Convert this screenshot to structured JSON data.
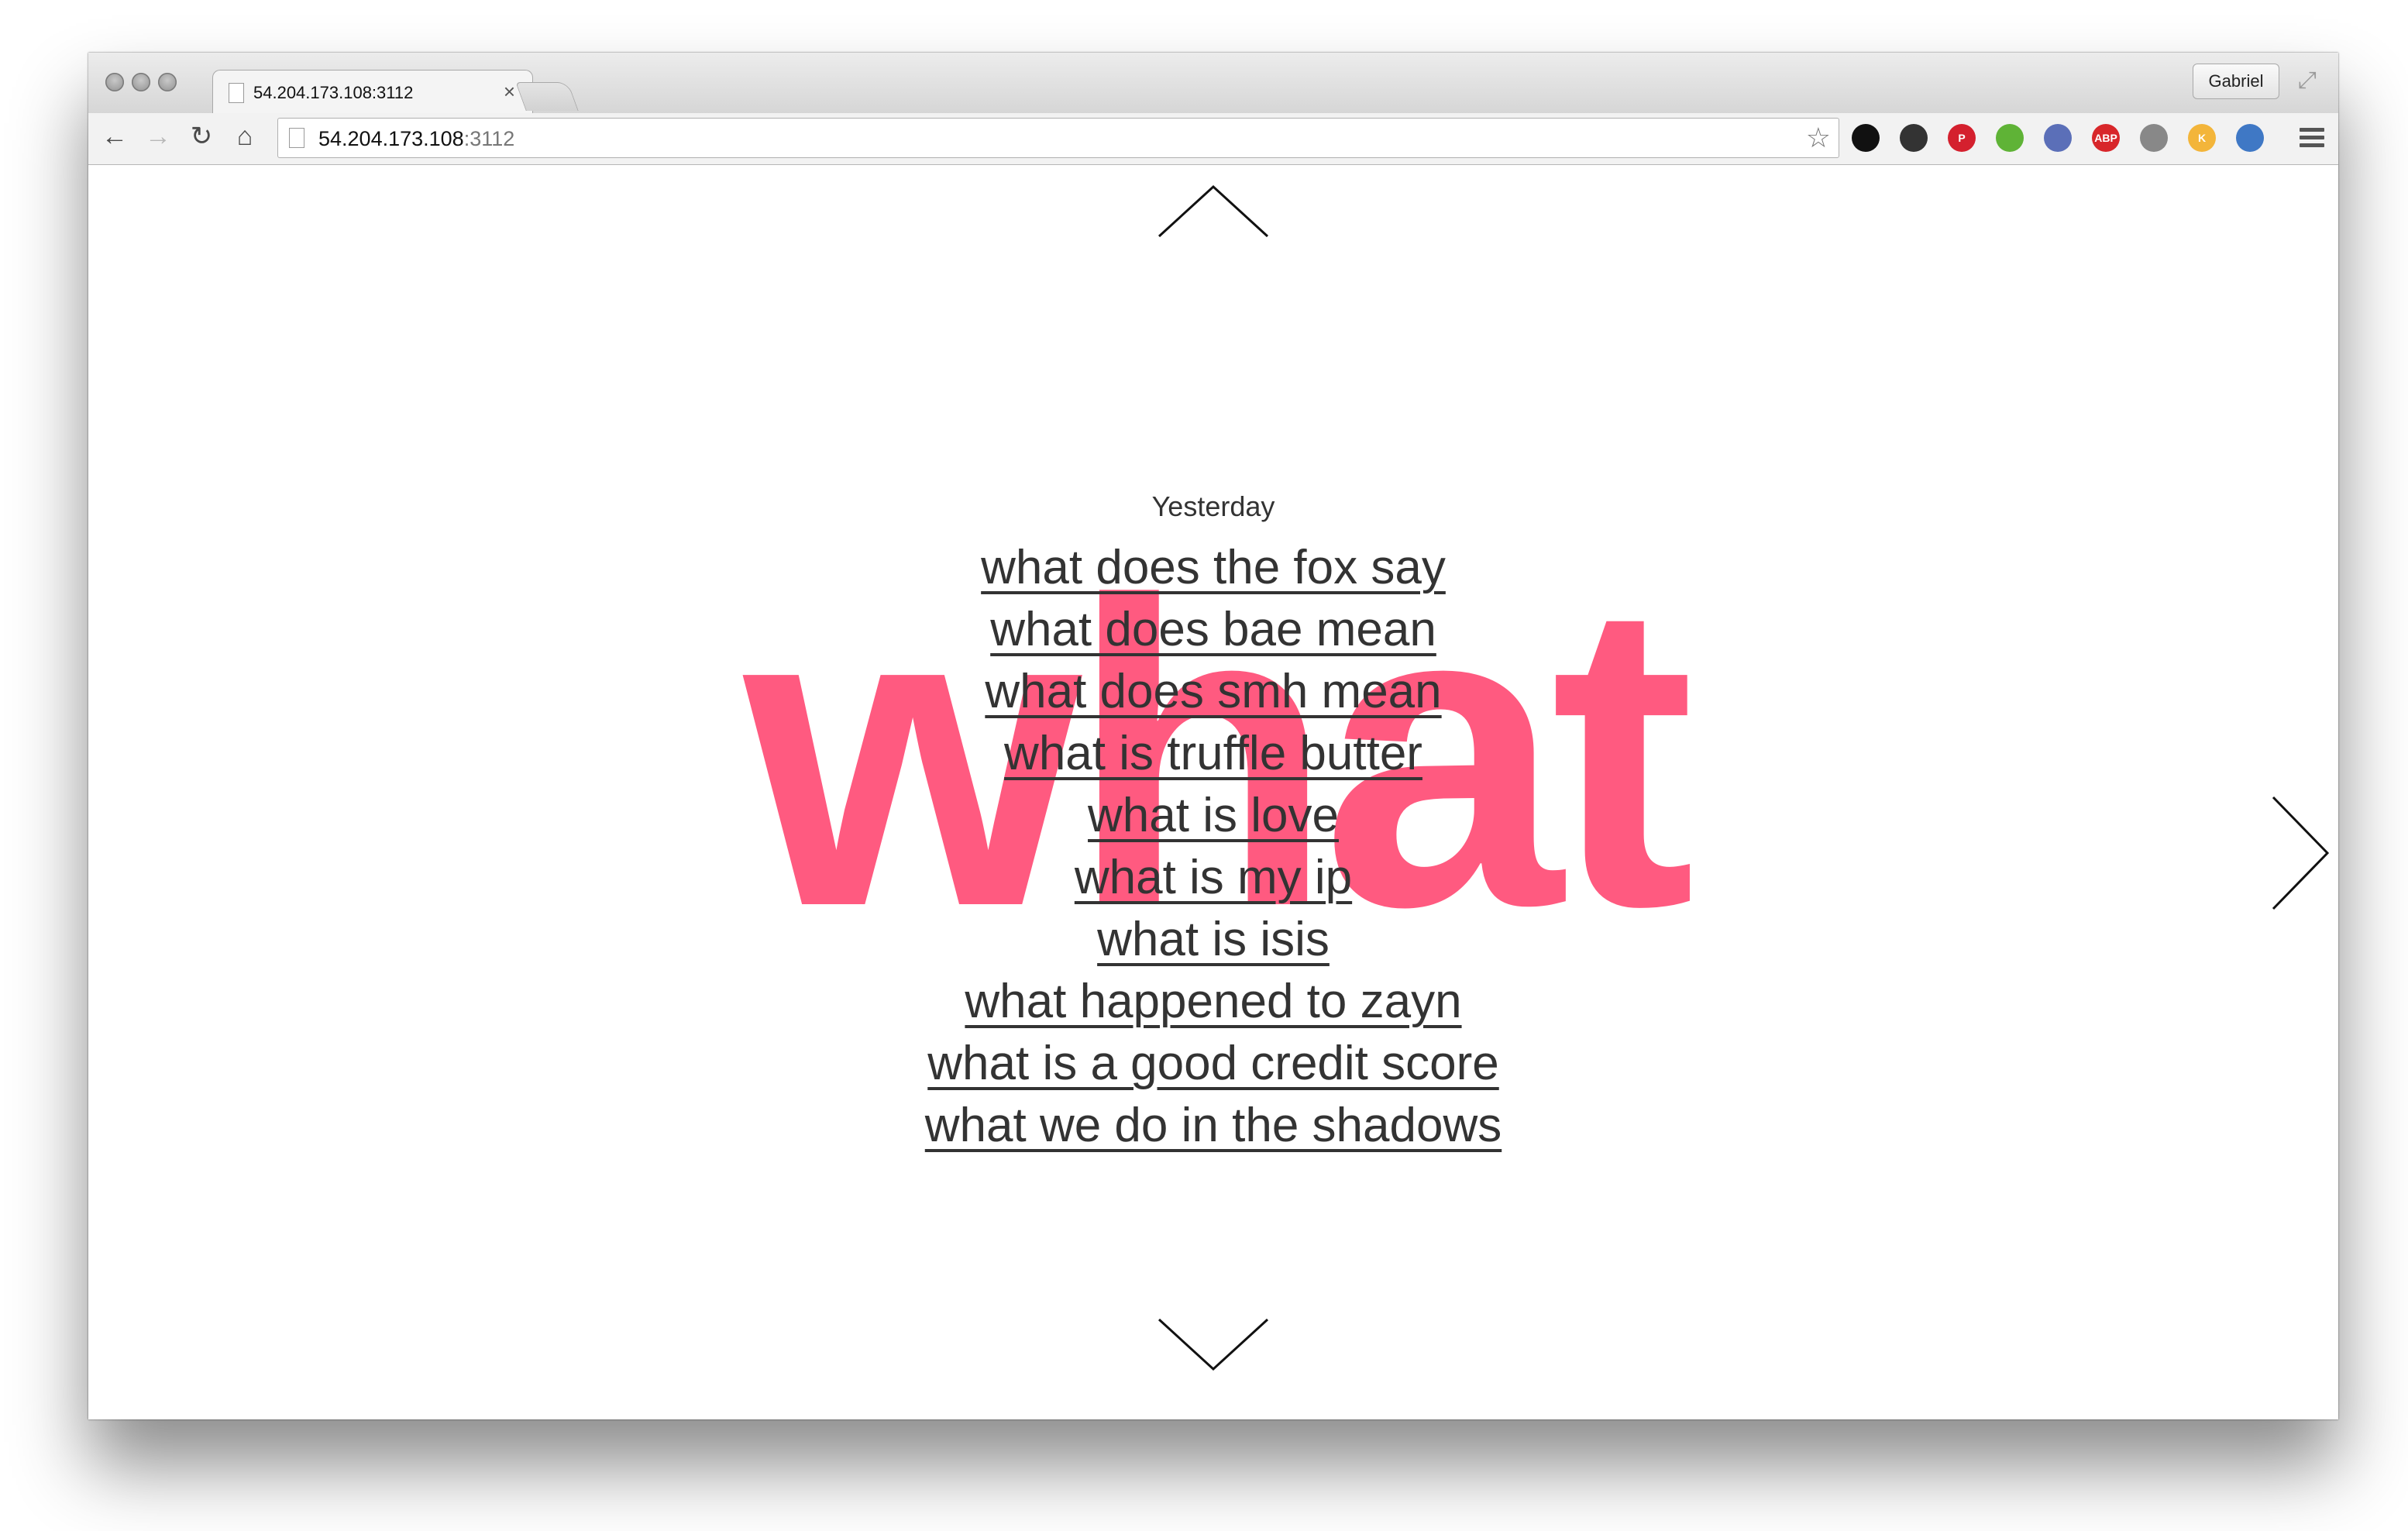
{
  "browser": {
    "tab_title": "54.204.173.108:3112",
    "tab_close": "×",
    "profile_name": "Gabriel",
    "url_host": "54.204.173.108",
    "url_port": ":3112",
    "nav": {
      "back_icon": "←",
      "forward_icon": "→",
      "reload_icon": "↻",
      "home_icon": "⌂",
      "star_icon": "☆"
    },
    "extensions": [
      {
        "name": "delicious-icon",
        "color": "#111111",
        "label": ""
      },
      {
        "name": "color-picker-icon",
        "color": "#333333",
        "label": ""
      },
      {
        "name": "pinterest-icon",
        "color": "#d4202e",
        "label": "P"
      },
      {
        "name": "evernote-icon",
        "color": "#5fb336",
        "label": ""
      },
      {
        "name": "eyedropper-icon",
        "color": "#5b6fb8",
        "label": ""
      },
      {
        "name": "adblock-plus-icon",
        "color": "#d8262a",
        "label": "ABP"
      },
      {
        "name": "pocket-icon",
        "color": "#888888",
        "label": ""
      },
      {
        "name": "klout-icon",
        "color": "#f3b53a",
        "label": "K"
      },
      {
        "name": "screen-capture-icon",
        "color": "#3f78c5",
        "label": ""
      }
    ]
  },
  "page": {
    "big_word": "what",
    "date_label": "Yesterday",
    "queries": [
      "what does the fox say",
      "what does bae mean",
      "what does smh mean",
      "what is truffle butter",
      "what is love",
      "what is my ip",
      "what is isis",
      "what happened to zayn",
      "what is a good credit score",
      "what we do in the shadows"
    ],
    "colors": {
      "accent": "#ff2c5c",
      "text": "#333333"
    }
  }
}
